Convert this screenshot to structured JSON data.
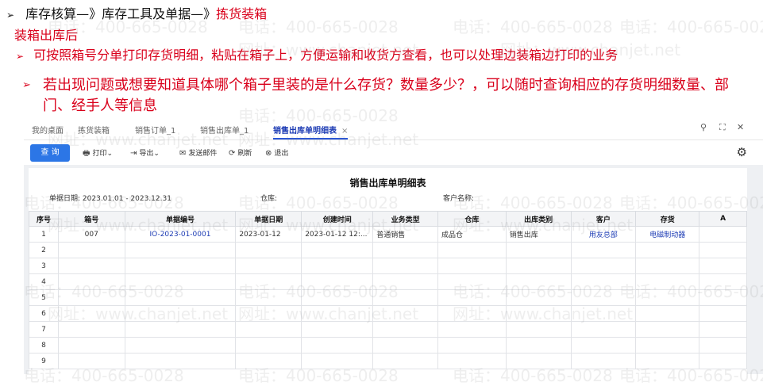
{
  "slide": {
    "line1_prefix": "库存核算—》库存工具及单据—》",
    "line1_highlight": "拣货装箱",
    "line2": "装箱出库后",
    "line3": "可按照箱号分单打印存货明细，粘贴在箱子上，方便运输和收货方查看，也可以处理边装箱边打印的业务",
    "bullet": "若出现问题或想要知道具体哪个箱子里装的是什么存货？数量多少？，可以随时查询相应的存货明细数量、部门、经手人等信息",
    "arrow": "➢"
  },
  "watermark": {
    "phone": "电话：400-665-0028",
    "site": "网址：www.chanjet.net"
  },
  "tabs": [
    {
      "label": "我的桌面"
    },
    {
      "label": "拣货装箱"
    },
    {
      "label": "销售订单_1"
    },
    {
      "label": "销售出库单_1"
    },
    {
      "label": "销售出库单明细表",
      "close": "×"
    }
  ],
  "window_controls": {
    "search": "⚲",
    "restore": "⛶",
    "close": "✕"
  },
  "toolbar": {
    "query": "查 询",
    "print": "打印",
    "export": "导出",
    "email": "发送邮件",
    "refresh": "刷新",
    "exit": "退出",
    "dropdown": "⌄"
  },
  "report": {
    "title": "销售出库单明细表",
    "date_label": "单据日期:",
    "date_value": "2023.01.01 - 2023.12.31",
    "warehouse_label": "仓库:",
    "customer_label": "客户名称:"
  },
  "table": {
    "headers": [
      "序号",
      "箱号",
      "单据编号",
      "单据日期",
      "创建时间",
      "业务类型",
      "仓库",
      "出库类别",
      "客户",
      "存货",
      "A"
    ],
    "rows": [
      [
        "1",
        "007",
        "IO-2023-01-0001",
        "2023-01-12",
        "2023-01-12 12:...",
        "普通销售",
        "成品仓",
        "销售出库",
        "用友总部",
        "电磁制动器",
        ""
      ],
      [
        "2",
        "",
        "",
        "",
        "",
        "",
        "",
        "",
        "",
        "",
        ""
      ],
      [
        "3",
        "",
        "",
        "",
        "",
        "",
        "",
        "",
        "",
        "",
        ""
      ],
      [
        "4",
        "",
        "",
        "",
        "",
        "",
        "",
        "",
        "",
        "",
        ""
      ],
      [
        "5",
        "",
        "",
        "",
        "",
        "",
        "",
        "",
        "",
        "",
        ""
      ],
      [
        "6",
        "",
        "",
        "",
        "",
        "",
        "",
        "",
        "",
        "",
        ""
      ],
      [
        "7",
        "",
        "",
        "",
        "",
        "",
        "",
        "",
        "",
        "",
        ""
      ],
      [
        "8",
        "",
        "",
        "",
        "",
        "",
        "",
        "",
        "",
        "",
        ""
      ],
      [
        "9",
        "",
        "",
        "",
        "",
        "",
        "",
        "",
        "",
        "",
        ""
      ]
    ]
  },
  "colors": {
    "accent": "#2c76e6",
    "highlight": "#d9001b",
    "link": "#1c3bb4"
  }
}
